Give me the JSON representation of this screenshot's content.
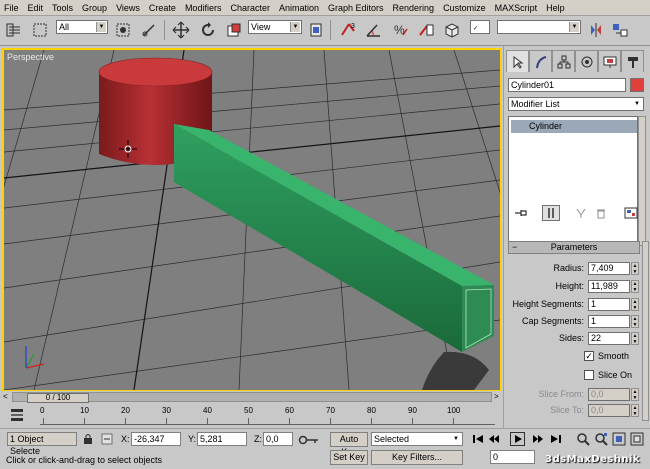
{
  "menu": [
    "File",
    "Edit",
    "Tools",
    "Group",
    "Views",
    "Create",
    "Modifiers",
    "Character",
    "Animation",
    "Graph Editors",
    "Rendering",
    "Customize",
    "MAXScript",
    "Help"
  ],
  "toolbar": {
    "selection_filter": "All",
    "reference_coord": "View",
    "named_selection": ""
  },
  "viewport": {
    "label": "Perspective"
  },
  "panel": {
    "object_name": "Cylinder01",
    "object_color": "#e0403c",
    "modifier_list": "Modifier List",
    "stack_item": "Cylinder",
    "rollout_title": "Parameters",
    "params": [
      {
        "label": "Radius:",
        "value": "7,409",
        "enabled": true
      },
      {
        "label": "Height:",
        "value": "11,989",
        "enabled": true
      },
      {
        "label": "Height Segments:",
        "value": "1",
        "enabled": true
      },
      {
        "label": "Cap Segments:",
        "value": "1",
        "enabled": true
      },
      {
        "label": "Sides:",
        "value": "22",
        "enabled": true
      }
    ],
    "smooth_label": "Smooth",
    "smooth_checked": true,
    "slice_on_label": "Slice On",
    "slice_on_checked": false,
    "slice_from_label": "Slice From:",
    "slice_from_value": "0,0",
    "slice_to_label": "Slice To:",
    "slice_to_value": "0,0"
  },
  "timeline": {
    "frame_display": "0 / 100",
    "ticks": [
      "0",
      "10",
      "20",
      "30",
      "40",
      "50",
      "60",
      "70",
      "80",
      "90",
      "100"
    ]
  },
  "status": {
    "selection_count": "1 Object Selecte",
    "x_label": "X:",
    "x_value": "-26,347",
    "y_label": "Y:",
    "y_value": "5,281",
    "z_label": "Z:",
    "z_value": "0,0",
    "auto_key": "Auto Key",
    "key_mode": "Selected",
    "set_key": "Set Key",
    "key_filters": "Key Filters...",
    "current_frame": "0",
    "prompt": "Click or click-and-drag to select objects",
    "watermark": "3dsMaxDeshnik"
  }
}
